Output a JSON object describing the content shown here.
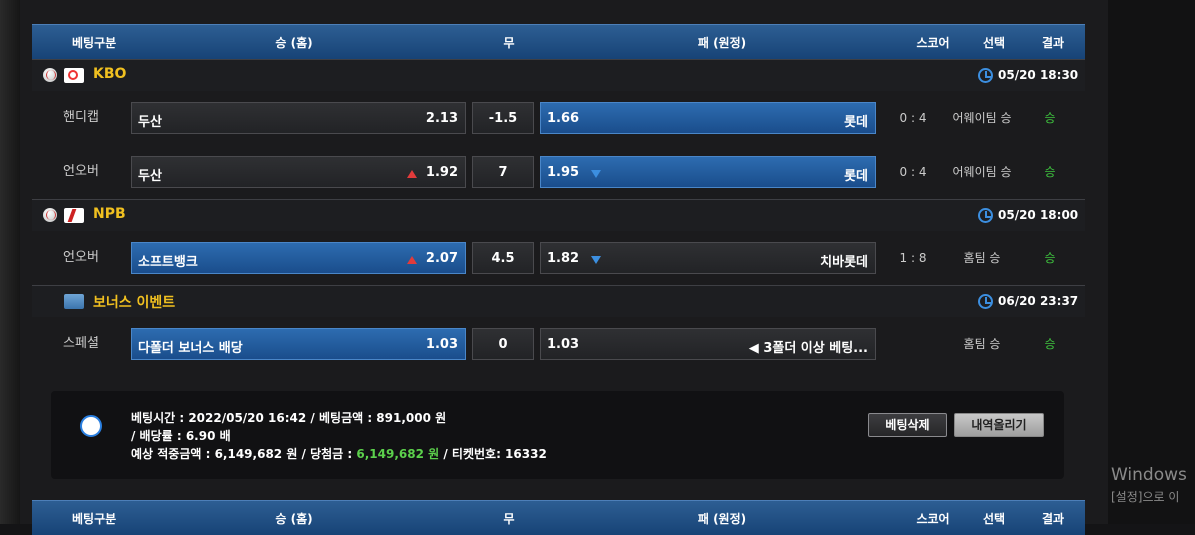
{
  "header": {
    "type": "베팅구분",
    "home": "승 (홈)",
    "draw": "무",
    "away": "패 (원정)",
    "score": "스코어",
    "pick": "선택",
    "result": "결과"
  },
  "leagues": [
    {
      "name": "KBO",
      "time": "05/20 18:30",
      "logo": "kbo-logo-icon"
    },
    {
      "name": "NPB",
      "time": "05/20 18:00",
      "logo": "npb-logo-icon"
    },
    {
      "name": "보너스 이벤트",
      "time": "06/20 23:37",
      "logo": "bonus-event-icon"
    }
  ],
  "rows": [
    {
      "type": "핸디캡",
      "home_team": "두산",
      "home_odds": "2.13",
      "draw": "-1.5",
      "away_odds": "1.66",
      "away_team": "롯데",
      "score": "0 : 4",
      "pick": "어웨이팀 승",
      "result": "승"
    },
    {
      "type": "언오버",
      "home_team": "두산",
      "home_odds": "1.92",
      "draw": "7",
      "away_odds": "1.95",
      "away_team": "롯데",
      "score": "0 : 4",
      "pick": "어웨이팀 승",
      "result": "승"
    },
    {
      "type": "언오버",
      "home_team": "소프트뱅크",
      "home_odds": "2.07",
      "draw": "4.5",
      "away_odds": "1.82",
      "away_team": "치바롯데",
      "score": "1 : 8",
      "pick": "홈팀 승",
      "result": "승"
    },
    {
      "type": "스페셜",
      "home_team": "다폴더 보너스 배당",
      "home_odds": "1.03",
      "draw": "0",
      "away_odds": "1.03",
      "away_team": "◀ 3폴더 이상 베팅...",
      "score": "",
      "pick": "홈팀 승",
      "result": "승"
    }
  ],
  "summary": {
    "line1": "베팅시간 :  2022/05/20 16:42  /  베팅금액 :  891,000 원",
    "line2": "/ 배당률  :  6.90 배",
    "line3_a": "예상 적중금액  :  6,149,682 원  /  당첨금  :  ",
    "line3_b": "6,149,682 원",
    "line3_c": " / 티켓번호: 16332",
    "delete_btn": "베팅삭제",
    "upload_btn": "내역올리기"
  },
  "windows": {
    "line1": "Windows",
    "line2": "[설정]으로 이"
  },
  "colors": {
    "header_blue": "#1f4f86",
    "selected_blue": "#2d6cb0",
    "league_name": "#f0c020",
    "win_green": "#3ec43e",
    "up_red": "#e23b3b",
    "down_blue": "#3c8fe0"
  }
}
